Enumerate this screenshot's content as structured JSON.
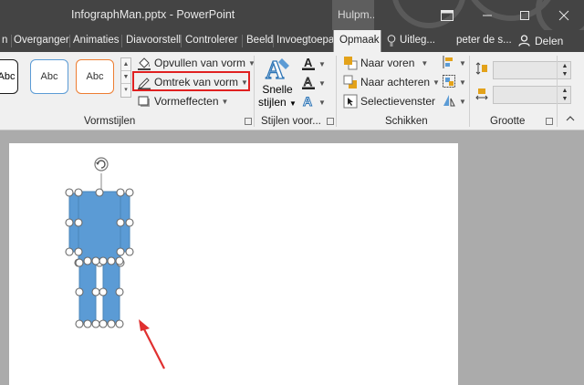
{
  "window": {
    "title": "InfographMan.pptx - PowerPoint",
    "context_tab_group": "Hulpm..."
  },
  "tabs": [
    {
      "label": "n",
      "active": false
    },
    {
      "label": "Overganger",
      "active": false
    },
    {
      "label": "Animaties",
      "active": false
    },
    {
      "label": "Diavoorstell",
      "active": false
    },
    {
      "label": "Controlerer",
      "active": false
    },
    {
      "label": "Beeld",
      "active": false
    },
    {
      "label": "Invoegtoepa",
      "active": false
    },
    {
      "label": "Opmaak",
      "active": true
    },
    {
      "label": "Uitleg...",
      "active": false
    },
    {
      "label": "peter de s...",
      "active": false
    },
    {
      "label": "Delen",
      "active": false
    }
  ],
  "ribbon": {
    "shape_styles": {
      "swatches": [
        "Abc",
        "Abc",
        "Abc"
      ],
      "fill_label": "Opvullen van vorm",
      "outline_label": "Omtrek van vorm",
      "effects_label": "Vormeffecten",
      "group_label": "Vormstijlen"
    },
    "wordart": {
      "quick_styles_line1": "Snelle",
      "quick_styles_line2": "stijlen",
      "group_label": "Stijlen voor..."
    },
    "arrange": {
      "bring_forward": "Naar voren",
      "send_backward": "Naar achteren",
      "selection_pane": "Selectievenster",
      "group_label": "Schikken"
    },
    "size": {
      "height_value": "",
      "width_value": "",
      "group_label": "Grootte"
    }
  },
  "colors": {
    "titlebar": "#444444",
    "ribbon": "#f0f0f0",
    "shape_fill": "#5b9bd5",
    "highlight": "#e02020",
    "arrow": "#e03030"
  },
  "slide": {
    "selected_shape": "infograph-man"
  }
}
